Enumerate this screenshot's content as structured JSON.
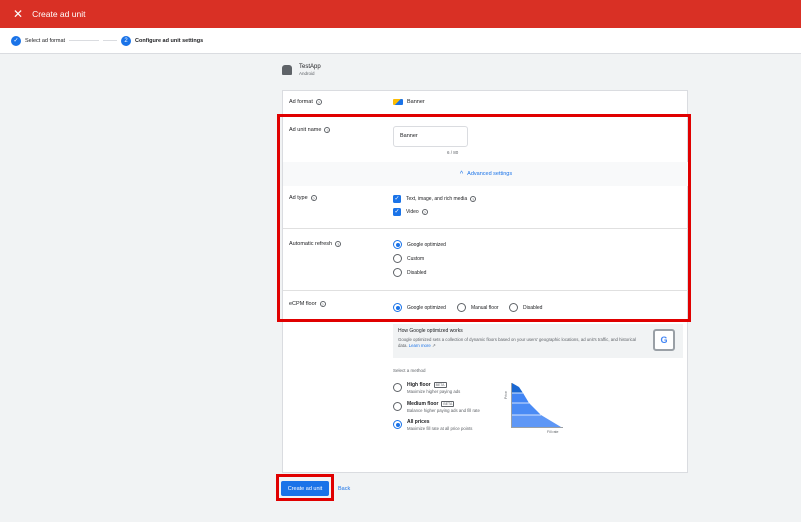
{
  "topbar": {
    "close_icon": "close-icon",
    "title": "Create ad unit"
  },
  "stepper": {
    "steps": [
      {
        "label": "Select ad format",
        "state": "done"
      },
      {
        "label": "Configure ad unit settings",
        "state": "active",
        "number": "2"
      }
    ]
  },
  "app": {
    "name": "TestApp",
    "platform": "Android",
    "icon": "android-icon"
  },
  "form": {
    "ad_format": {
      "label": "Ad format",
      "value": "Banner"
    },
    "ad_unit_name": {
      "label": "Ad unit name",
      "value": "Banner",
      "counter": "6 / 80"
    },
    "advanced_settings": {
      "label": "Advanced settings"
    },
    "ad_type": {
      "label": "Ad type",
      "options": [
        {
          "label": "Text, image, and rich media",
          "checked": true
        },
        {
          "label": "Video",
          "checked": true
        }
      ]
    },
    "automatic_refresh": {
      "label": "Automatic refresh",
      "options": [
        {
          "label": "Google optimized",
          "selected": true
        },
        {
          "label": "Custom",
          "selected": false
        },
        {
          "label": "Disabled",
          "selected": false
        }
      ]
    },
    "ecpm_floor": {
      "label": "eCPM floor",
      "options": [
        {
          "label": "Google optimized",
          "selected": true
        },
        {
          "label": "Manual floor",
          "selected": false
        },
        {
          "label": "Disabled",
          "selected": false
        }
      ]
    },
    "info": {
      "title": "How Google optimized works",
      "text": "Google optimized sets a collection of dynamic floors based on your users' geographic locations, ad unit's traffic, and historical data.",
      "link": "Learn more",
      "icon_letter": "G"
    },
    "method": {
      "label": "Select a method",
      "options": [
        {
          "title": "High floor",
          "badge": "BETA",
          "sub": "Maximize higher paying ads",
          "selected": false
        },
        {
          "title": "Medium floor",
          "badge": "BETA",
          "sub": "Balance higher paying ads and fill rate",
          "selected": false
        },
        {
          "title": "All prices",
          "badge": "",
          "sub": "Maximize fill rate at all price points",
          "selected": true
        }
      ]
    },
    "graph": {
      "y_label": "Price",
      "x_label": "Fill rate"
    }
  },
  "footer": {
    "create_label": "Create ad unit",
    "back_label": "Back"
  },
  "colors": {
    "accent": "#1a73e8",
    "topbar": "#d93025",
    "highlight": "#e00000"
  }
}
